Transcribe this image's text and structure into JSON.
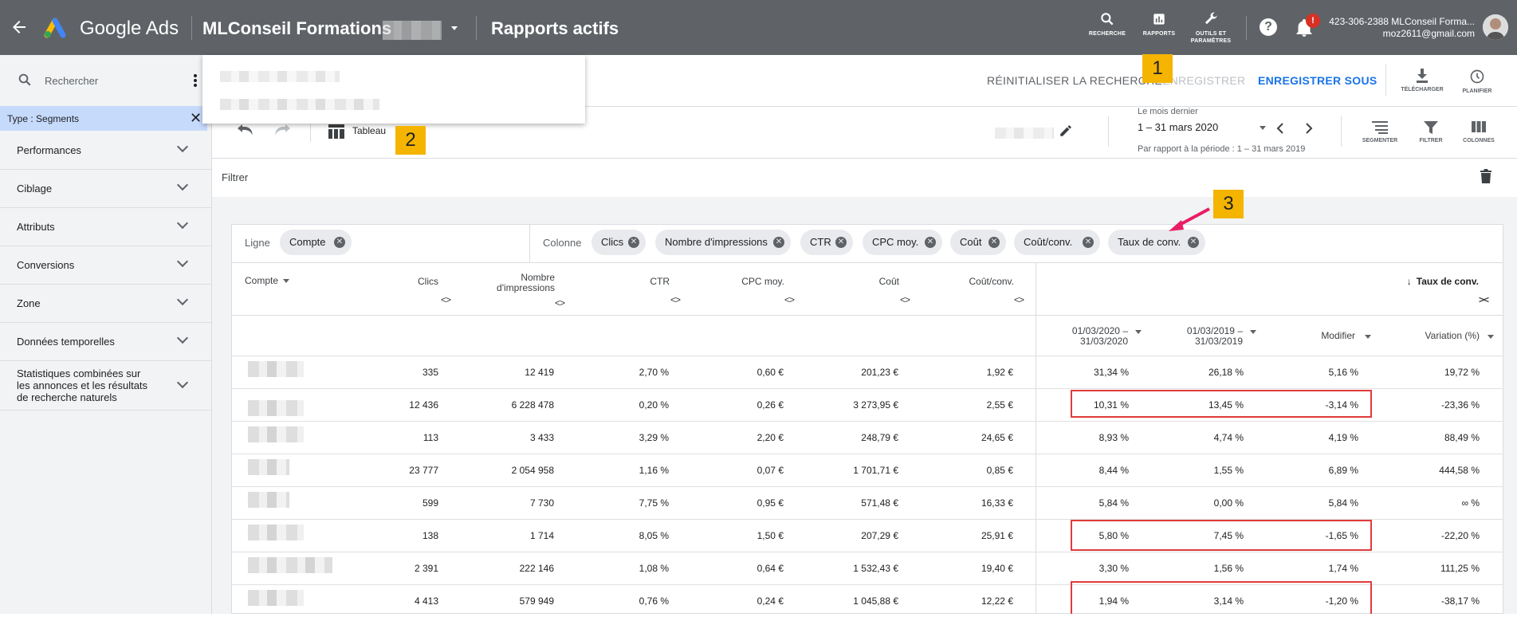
{
  "header": {
    "brand": "Google Ads",
    "account_name": "MLConseil Formations",
    "page_title": "Rapports actifs",
    "icons": [
      {
        "label": "RECHERCHE",
        "icon": "search-icon"
      },
      {
        "label": "RAPPORTS",
        "icon": "reports-icon"
      },
      {
        "label": "OUTILS ET PARAMÈTRES",
        "icon": "wrench-icon"
      }
    ],
    "notification_badge": "!",
    "account_line1": "423-306-2388 MLConseil Forma...",
    "account_line2": "moz2611@gmail.com"
  },
  "sidebar": {
    "search_placeholder": "Rechercher",
    "active_chip": "Type : Segments",
    "items": [
      {
        "label": "Performances"
      },
      {
        "label": "Ciblage"
      },
      {
        "label": "Attributs"
      },
      {
        "label": "Conversions"
      },
      {
        "label": "Zone"
      },
      {
        "label": "Données temporelles"
      },
      {
        "label": "Statistiques combinées sur les annonces et les résultats de recherche naturels"
      }
    ]
  },
  "actions": {
    "reset": "RÉINITIALISER LA RECHERCHE",
    "save": "ENREGISTRER",
    "save_as": "ENREGISTRER SOUS",
    "download": "TÉLÉCHARGER",
    "schedule": "PLANIFIER"
  },
  "toolbar": {
    "view_label": "Tableau",
    "date_caption": "Le mois dernier",
    "date_range": "1 – 31 mars 2020",
    "compare_text": "Par rapport à la période : 1 – 31 mars 2019",
    "segment": "SEGMENTER",
    "filter": "FILTRER",
    "columns": "COLONNES"
  },
  "filter_bar": {
    "label": "Filtrer"
  },
  "annotations": [
    "1",
    "2",
    "3"
  ],
  "pivot": {
    "row_label": "Ligne",
    "row_chips": [
      "Compte"
    ],
    "column_label": "Colonne",
    "column_chips": [
      "Clics",
      "Nombre d'impressions",
      "CTR",
      "CPC moy.",
      "Coût",
      "Coût/conv.",
      "Taux de conv."
    ]
  },
  "table": {
    "headers": {
      "compte": "Compte",
      "clics": "Clics",
      "impr": "Nombre d'impressions",
      "ctr": "CTR",
      "cpc": "CPC moy.",
      "cout": "Coût",
      "coutconv": "Coût/conv.",
      "taux": "Taux de conv.",
      "period_a": "01/03/2020 – 31/03/2020",
      "period_b": "01/03/2019 – 31/03/2019",
      "modifier": "Modifier",
      "variation": "Variation (%)"
    },
    "expand_icon": "<>",
    "collapse_icon": "><",
    "rows": [
      {
        "clics": "335",
        "impr": "12 419",
        "ctr": "2,70 %",
        "cpc": "0,60 €",
        "cout": "201,23 €",
        "coutconv": "1,92 €",
        "a": "31,34 %",
        "b": "26,18 %",
        "mod": "5,16 %",
        "var": "19,72 %"
      },
      {
        "clics": "12 436",
        "impr": "6 228 478",
        "ctr": "0,20 %",
        "cpc": "0,26 €",
        "cout": "3 273,95 €",
        "coutconv": "2,55 €",
        "a": "10,31 %",
        "b": "13,45 %",
        "mod": "-3,14 %",
        "var": "-23,36 %"
      },
      {
        "clics": "113",
        "impr": "3 433",
        "ctr": "3,29 %",
        "cpc": "2,20 €",
        "cout": "248,79 €",
        "coutconv": "24,65 €",
        "a": "8,93 %",
        "b": "4,74 %",
        "mod": "4,19 %",
        "var": "88,49 %"
      },
      {
        "clics": "23 777",
        "impr": "2 054 958",
        "ctr": "1,16 %",
        "cpc": "0,07 €",
        "cout": "1 701,71 €",
        "coutconv": "0,85 €",
        "a": "8,44 %",
        "b": "1,55 %",
        "mod": "6,89 %",
        "var": "444,58 %"
      },
      {
        "clics": "599",
        "impr": "7 730",
        "ctr": "7,75 %",
        "cpc": "0,95 €",
        "cout": "571,48 €",
        "coutconv": "16,33 €",
        "a": "5,84 %",
        "b": "0,00 %",
        "mod": "5,84 %",
        "var": "∞ %"
      },
      {
        "clics": "138",
        "impr": "1 714",
        "ctr": "8,05 %",
        "cpc": "1,50 €",
        "cout": "207,29 €",
        "coutconv": "25,91 €",
        "a": "5,80 %",
        "b": "7,45 %",
        "mod": "-1,65 %",
        "var": "-22,20 %"
      },
      {
        "clics": "2 391",
        "impr": "222 146",
        "ctr": "1,08 %",
        "cpc": "0,64 €",
        "cout": "1 532,43 €",
        "coutconv": "19,40 €",
        "a": "3,30 %",
        "b": "1,56 %",
        "mod": "1,74 %",
        "var": "111,25 %"
      },
      {
        "clics": "4 413",
        "impr": "579 949",
        "ctr": "0,76 %",
        "cpc": "0,24 €",
        "cout": "1 045,88 €",
        "coutconv": "12,22 €",
        "a": "1,94 %",
        "b": "3,14 %",
        "mod": "-1,20 %",
        "var": "-38,17 %"
      }
    ]
  },
  "colors": {
    "header_bg": "#5f6368",
    "accent_blue": "#1a73e8",
    "annotation_yellow": "#f4b400",
    "highlight_red": "#e03b3b",
    "arrow_pink": "#e91e63"
  }
}
